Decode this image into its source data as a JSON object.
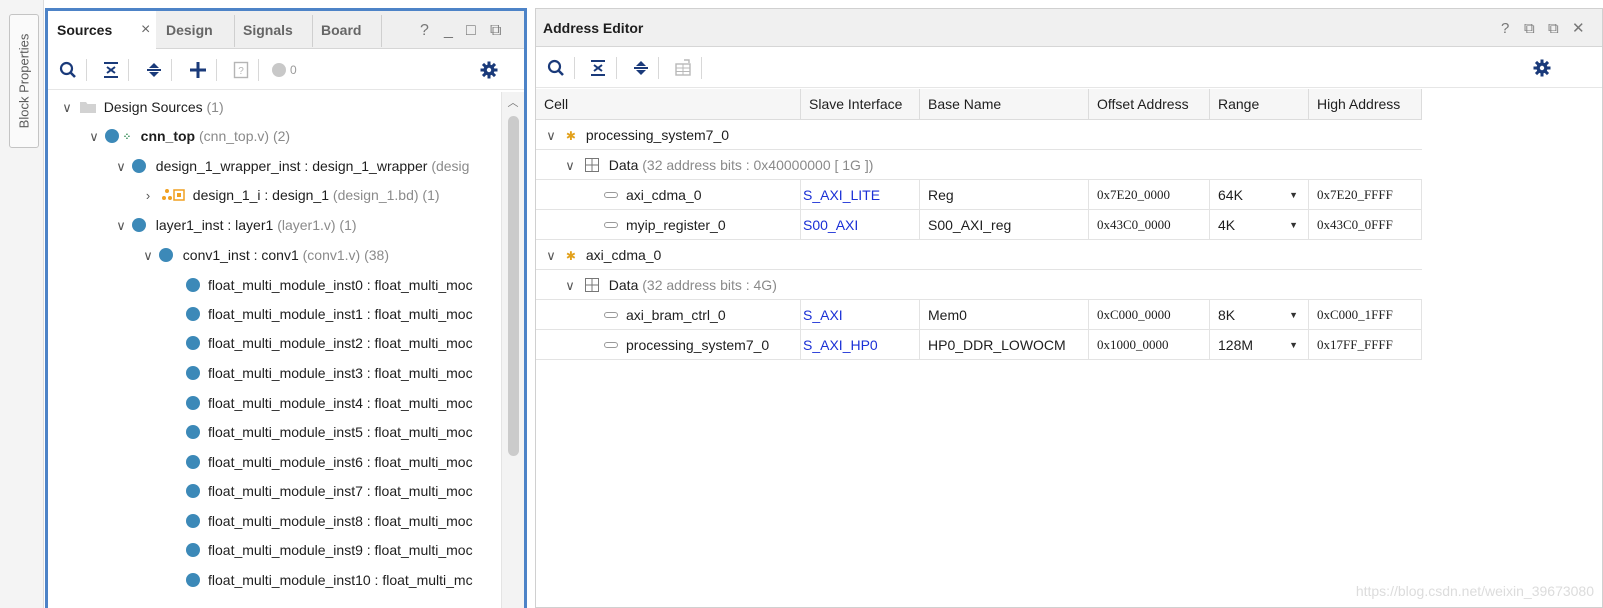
{
  "side_strip": {
    "tab_label": "Block Properties"
  },
  "sources": {
    "tabs": [
      {
        "label": "Sources",
        "close": "×"
      },
      {
        "label": "Design"
      },
      {
        "label": "Signals"
      },
      {
        "label": "Board"
      }
    ],
    "controls": {
      "help": "?",
      "minimize": "_",
      "maximize": "□",
      "float": "⧉"
    },
    "toolbar": {
      "error_count": "0"
    },
    "tree": [
      {
        "name": "Design Sources",
        "suffix": "(1)"
      },
      {
        "name": "cnn_top",
        "suffix": "(cnn_top.v) (2)"
      },
      {
        "name": "design_1_wrapper_inst : design_1_wrapper",
        "suffix": "(desig"
      },
      {
        "name": "design_1_i : design_1",
        "suffix": "(design_1.bd) (1)"
      },
      {
        "name": "layer1_inst : layer1",
        "suffix": "(layer1.v) (1)"
      },
      {
        "name": "conv1_inst : conv1",
        "suffix": "(conv1.v) (38)"
      },
      {
        "name": "float_multi_module_inst0 : float_multi_moc"
      },
      {
        "name": "float_multi_module_inst1 : float_multi_moc"
      },
      {
        "name": "float_multi_module_inst2 : float_multi_moc"
      },
      {
        "name": "float_multi_module_inst3 : float_multi_moc"
      },
      {
        "name": "float_multi_module_inst4 : float_multi_moc"
      },
      {
        "name": "float_multi_module_inst5 : float_multi_moc"
      },
      {
        "name": "float_multi_module_inst6 : float_multi_moc"
      },
      {
        "name": "float_multi_module_inst7 : float_multi_moc"
      },
      {
        "name": "float_multi_module_inst8 : float_multi_moc"
      },
      {
        "name": "float_multi_module_inst9 : float_multi_moc"
      },
      {
        "name": "float_multi_module_inst10 : float_multi_mc"
      }
    ]
  },
  "address_editor": {
    "title": "Address Editor",
    "controls": {
      "help": "?",
      "restore": "⧉",
      "float": "⧉",
      "close": "✕"
    },
    "columns": [
      "Cell",
      "Slave Interface",
      "Base Name",
      "Offset Address",
      "Range",
      "High Address"
    ],
    "rows": [
      {
        "cell": "processing_system7_0"
      },
      {
        "cell": "Data",
        "info": "(32 address bits : 0x40000000 [ 1G ])"
      },
      {
        "cell": "axi_cdma_0",
        "slave": "S_AXI_LITE",
        "base": "Reg",
        "offset": "0x7E20_0000",
        "range": "64K",
        "high": "0x7E20_FFFF"
      },
      {
        "cell": "myip_register_0",
        "slave": "S00_AXI",
        "base": "S00_AXI_reg",
        "offset": "0x43C0_0000",
        "range": "4K",
        "high": "0x43C0_0FFF"
      },
      {
        "cell": "axi_cdma_0"
      },
      {
        "cell": "Data",
        "info": "(32 address bits : 4G)"
      },
      {
        "cell": "axi_bram_ctrl_0",
        "slave": "S_AXI",
        "base": "Mem0",
        "offset": "0xC000_0000",
        "range": "8K",
        "high": "0xC000_1FFF"
      },
      {
        "cell": "processing_system7_0",
        "slave": "S_AXI_HP0",
        "base": "HP0_DDR_LOWOCM",
        "offset": "0x1000_0000",
        "range": "128M",
        "high": "0x17FF_FFFF"
      }
    ],
    "watermark": "https://blog.csdn.net/weixin_39673080"
  },
  "colors": {
    "panel_focus_border": "#4d83c7",
    "link": "#1a2fd6",
    "node_dot": "#3c89b8"
  }
}
